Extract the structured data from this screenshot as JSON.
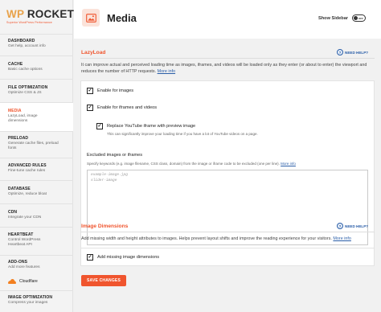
{
  "brand": {
    "name_wp": "WP",
    "name_rocket": "ROCKET",
    "tagline": "Superior WordPress Performance",
    "accent": "#f0552e"
  },
  "sidebar": {
    "items": [
      {
        "title": "DASHBOARD",
        "sub": "Get help, account info"
      },
      {
        "title": "CACHE",
        "sub": "Basic cache options"
      },
      {
        "title": "FILE OPTIMIZATION",
        "sub": "Optimize CSS & JS"
      },
      {
        "title": "MEDIA",
        "sub": "LazyLoad, image dimensions"
      },
      {
        "title": "PRELOAD",
        "sub": "Generate cache files, preload fonts"
      },
      {
        "title": "ADVANCED RULES",
        "sub": "Fine-tune cache rules"
      },
      {
        "title": "DATABASE",
        "sub": "Optimize, reduce bloat"
      },
      {
        "title": "CDN",
        "sub": "Integrate your CDN"
      },
      {
        "title": "HEARTBEAT",
        "sub": "Control WordPress Heartbeat API"
      },
      {
        "title": "ADD-ONS",
        "sub": "Add more features"
      },
      {
        "title": "IMAGE OPTIMIZATION",
        "sub": "Compress your images"
      }
    ],
    "addon_cloudflare": "Cloudflare"
  },
  "header": {
    "title": "Media",
    "show_sidebar_label": "Show Sidebar",
    "toggle_state": "OFF",
    "icon": "image-icon"
  },
  "lazyload": {
    "title": "LazyLoad",
    "help_label": "NEED HELP?",
    "description": "It can improve actual and perceived loading time as images, iframes, and videos will be loaded only as they enter (or about to enter) the viewport and reduces the number of HTTP requests.",
    "more_info": "More info",
    "opt_images": {
      "label": "Enable for images",
      "checked": true
    },
    "opt_iframes": {
      "label": "Enable for iframes and videos",
      "checked": true
    },
    "opt_youtube": {
      "label": "Replace YouTube iframe with preview image",
      "sub": "This can significantly improve your loading time if you have a lot of YouTube videos on a page.",
      "checked": true
    },
    "excluded": {
      "label": "Excluded images or iframes",
      "help": "Specify keywords (e.g. image filename, CSS class, domain) from the image or iframe code to be excluded (one per line).",
      "more_info": "More info",
      "placeholder_line1": "example-image.jpg",
      "placeholder_line2": "slider-image"
    }
  },
  "dimensions": {
    "title": "Image Dimensions",
    "help_label": "NEED HELP?",
    "description": "Add missing width and height attributes to images. Helps prevent layout shifts and improve the reading experience for your visitors.",
    "more_info": "More info",
    "opt_missing": {
      "label": "Add missing image dimensions",
      "checked": true
    }
  },
  "save_button": "SAVE CHANGES"
}
